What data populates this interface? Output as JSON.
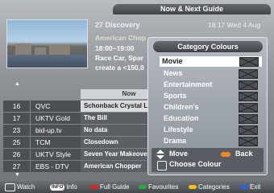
{
  "header": {
    "title": "Now & Next Guide"
  },
  "preview": {
    "channel_title": "27  Discovery",
    "datetime": "18:17 Wed 4 Aug",
    "programme": "American Chop",
    "time": "18:00~19:00",
    "desc_line1": "Race Car, Spar",
    "desc_line2": "create a <150,0"
  },
  "grid": {
    "column_header": "Now",
    "rows": [
      {
        "num": "16",
        "name": "QVC",
        "prog": "Schonback Crystal L",
        "selected": true
      },
      {
        "num": "17",
        "name": "UKTV Gold",
        "prog": "The Bill"
      },
      {
        "num": "23",
        "name": "bid-up.tv",
        "prog": "No data"
      },
      {
        "num": "25",
        "name": "TCM",
        "prog": "Closedown"
      },
      {
        "num": "26",
        "name": "UKTV Style",
        "prog": "Seven Year Makeove"
      },
      {
        "num": "27",
        "name": "EBS - DTV",
        "prog": "American Chopper"
      }
    ]
  },
  "popup": {
    "title": "Category Colours",
    "categories": [
      "Movie",
      "News",
      "Entertainment",
      "Sports",
      "Children's",
      "Education",
      "Lifestyle",
      "Drama"
    ],
    "selected_index": 0,
    "move_label": "Move",
    "back_label": "Back",
    "choose_label": "Choose Colour"
  },
  "bottom_bar": {
    "watch": "Watch",
    "info_key": "INFO",
    "info": "Info",
    "full_guide": "Full Guide",
    "favourites": "Favourites",
    "categories": "Categories",
    "exit": "Exit"
  },
  "colors": {
    "key_red": "#d8262b",
    "key_green": "#2fa84a",
    "key_yellow": "#f2c21c",
    "key_blue": "#2d63d6",
    "orange": "#f08a26"
  }
}
